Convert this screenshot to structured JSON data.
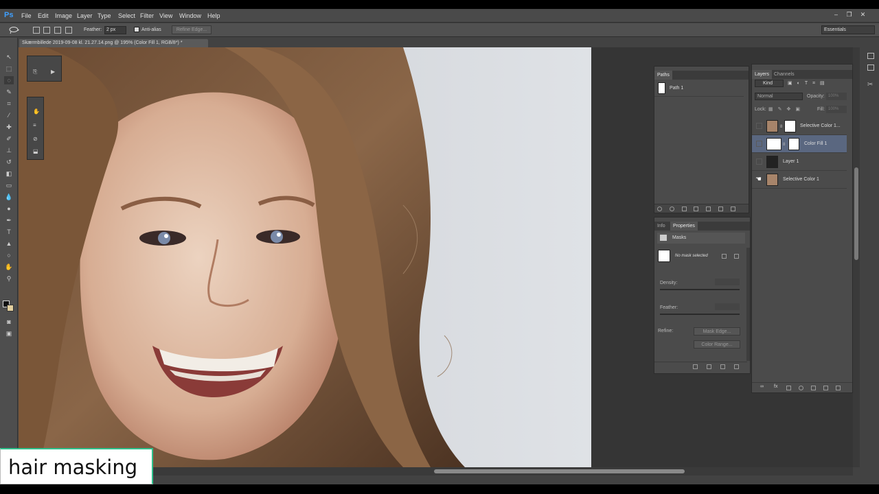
{
  "app": {
    "logo": "Ps"
  },
  "menu": [
    "File",
    "Edit",
    "Image",
    "Layer",
    "Type",
    "Select",
    "Filter",
    "View",
    "Window",
    "Help"
  ],
  "window_buttons": [
    "–",
    "❐",
    "✕"
  ],
  "options": {
    "feather_label": "Feather:",
    "feather_value": "2 px",
    "antialias_label": "Anti-alias",
    "refine_label": "Refine Edge...",
    "workspace": "Essentials"
  },
  "document": {
    "tab_title": "Skærmbillede 2019-09-08 kl. 21.27.14.png @ 195% (Color Fill 1, RGB/8*) *"
  },
  "paths_panel": {
    "tab": "Paths",
    "items": [
      {
        "name": "Path 1"
      }
    ]
  },
  "properties_panel": {
    "tabs": [
      "Info",
      "Properties"
    ],
    "active_tab": "Properties",
    "section": "Masks",
    "mask_status": "No mask selected",
    "density_label": "Density:",
    "feather_label": "Feather:",
    "refine_label": "Refine:",
    "mask_edge_btn": "Mask Edge...",
    "color_range_btn": "Color Range..."
  },
  "layers_panel": {
    "tabs": [
      "Layers",
      "Channels"
    ],
    "filter_kind": "Kind",
    "blend_mode": "Normal",
    "opacity_label": "Opacity:",
    "opacity_value": "100%",
    "lock_label": "Lock:",
    "fill_label": "Fill:",
    "fill_value": "100%",
    "layers": [
      {
        "name": "Selective Color 1...",
        "visible": false,
        "selected": false
      },
      {
        "name": "Color Fill 1",
        "visible": false,
        "selected": true
      },
      {
        "name": "Layer 1",
        "visible": false,
        "selected": false
      },
      {
        "name": "Selective Color 1",
        "visible": true,
        "selected": false
      }
    ]
  },
  "caption": {
    "text": "hair  masking"
  }
}
